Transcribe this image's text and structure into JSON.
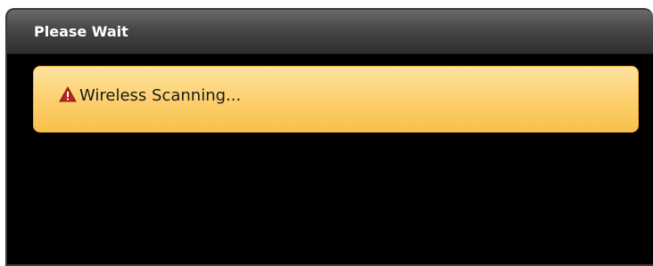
{
  "dialog": {
    "title": "Please Wait",
    "alert": {
      "icon": "warning-icon",
      "message": "Wireless Scanning...",
      "background": "#fdd274",
      "icon_color": "#b5281c"
    }
  }
}
